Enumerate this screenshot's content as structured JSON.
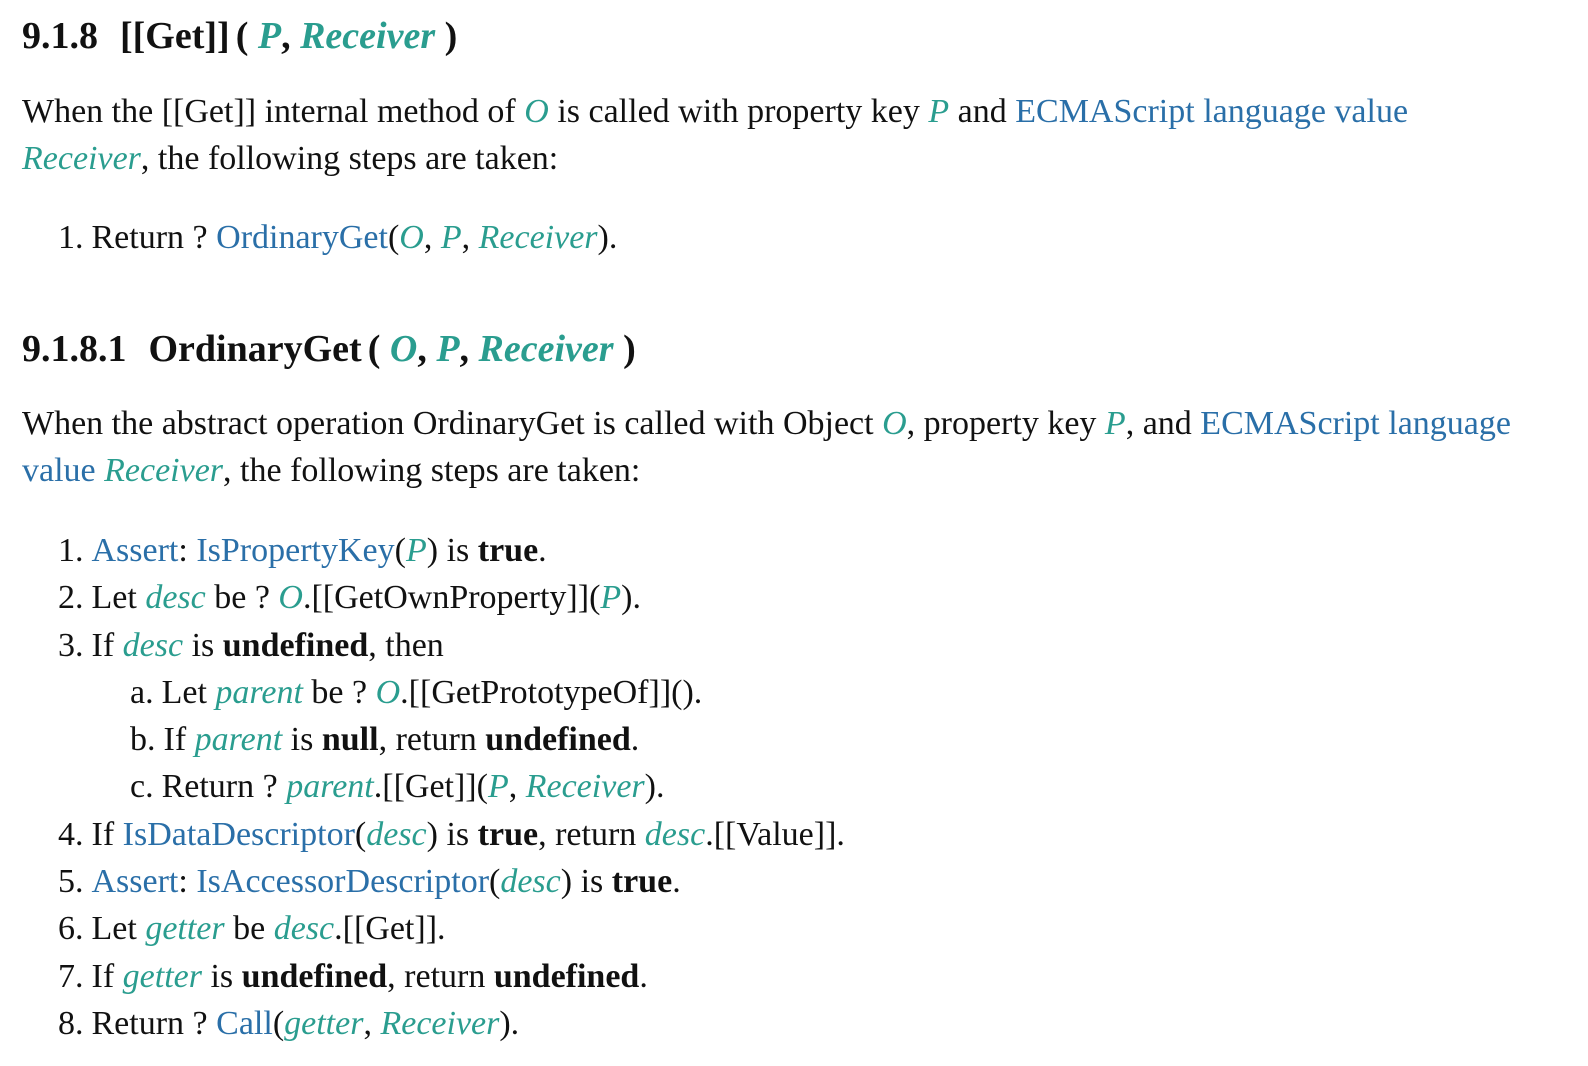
{
  "colors": {
    "variable": "#2a9d8f",
    "link": "#2a6fa8",
    "text": "#111111"
  },
  "common": {
    "O": "O",
    "P": "P",
    "Receiver": "Receiver",
    "desc": "desc",
    "parent": "parent",
    "getter": "getter",
    "true": "true",
    "undefined": "undefined",
    "null": "null",
    "ecma_value": "ECMAScript language value",
    "ecma_language": "ECMAScript language",
    "value": "value"
  },
  "section1": {
    "number": "9.1.8",
    "title": "[[Get]]",
    "intro_a": "When the [[Get]] internal method of ",
    "intro_b": " is called with property key ",
    "intro_c": " and ",
    "intro_d": ", the following steps are taken:",
    "step1": {
      "num": "1.",
      "a": "Return ? ",
      "fn": "OrdinaryGet",
      "b": "(",
      "c": ", ",
      "d": ", ",
      "e": ")."
    }
  },
  "section2": {
    "number": "9.1.8.1",
    "title": "OrdinaryGet",
    "intro_a": "When the abstract operation OrdinaryGet is called with Object ",
    "intro_b": ", property key ",
    "intro_c": ", and ",
    "intro_d": ", the following steps are taken:",
    "steps": {
      "s1": {
        "num": "1.",
        "assert": "Assert",
        "a": ": ",
        "fn": "IsPropertyKey",
        "b": "(",
        "c": ") is ",
        "d": "."
      },
      "s2": {
        "num": "2.",
        "a": "Let ",
        "b": " be ? ",
        "c": ".[[GetOwnProperty]](",
        "d": ")."
      },
      "s3": {
        "num": "3.",
        "a": "If ",
        "b": " is ",
        "c": ", then"
      },
      "s3a": {
        "num": "a.",
        "a": "Let ",
        "b": " be ? ",
        "c": ".[[GetPrototypeOf]]()."
      },
      "s3b": {
        "num": "b.",
        "a": "If ",
        "b": " is ",
        "c": ", return ",
        "d": "."
      },
      "s3c": {
        "num": "c.",
        "a": "Return ? ",
        "b": ".[[Get]](",
        "c": ", ",
        "d": ")."
      },
      "s4": {
        "num": "4.",
        "a": "If ",
        "fn": "IsDataDescriptor",
        "b": "(",
        "c": ") is ",
        "d": ", return ",
        "e": ".[[Value]]."
      },
      "s5": {
        "num": "5.",
        "assert": "Assert",
        "a": ": ",
        "fn": "IsAccessorDescriptor",
        "b": "(",
        "c": ") is ",
        "d": "."
      },
      "s6": {
        "num": "6.",
        "a": "Let ",
        "b": " be ",
        "c": ".[[Get]]."
      },
      "s7": {
        "num": "7.",
        "a": "If ",
        "b": " is ",
        "c": ", return ",
        "d": "."
      },
      "s8": {
        "num": "8.",
        "a": "Return ? ",
        "fn": "Call",
        "b": "(",
        "c": ", ",
        "d": ")."
      }
    }
  }
}
